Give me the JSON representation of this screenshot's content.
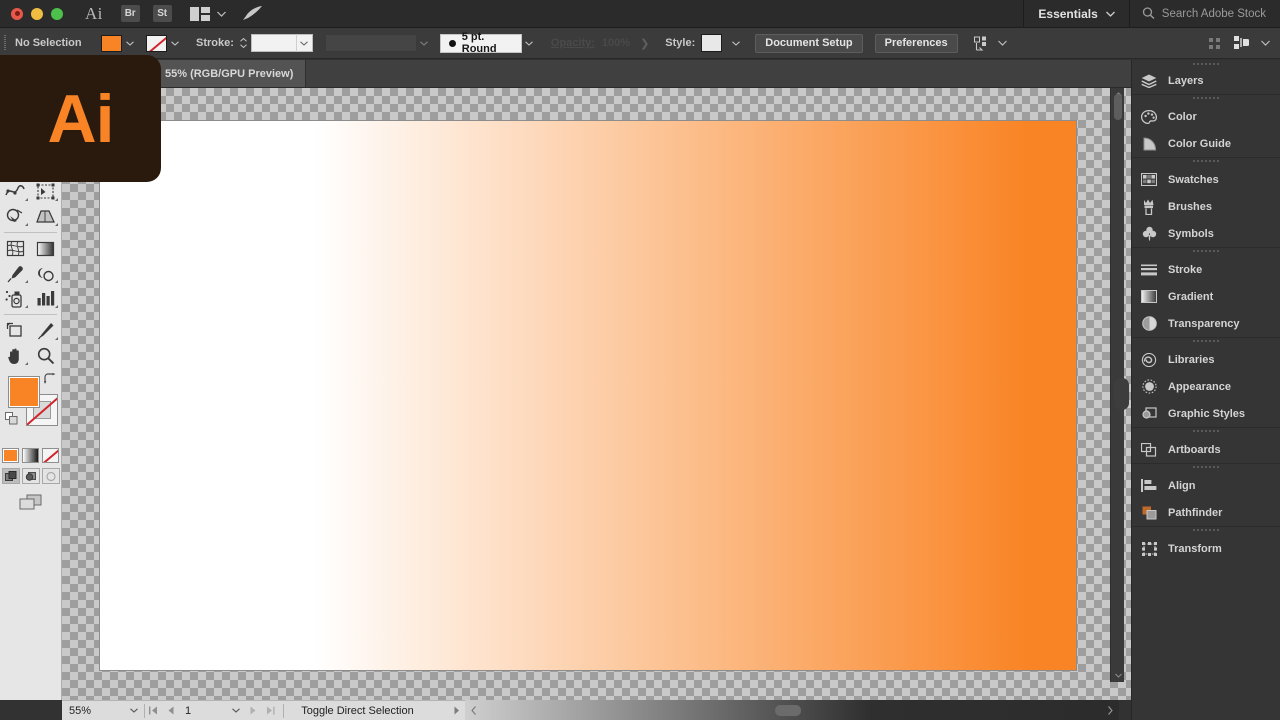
{
  "app": {
    "name": "Adobe Illustrator",
    "logo_text": "Ai",
    "brand_orange": "#f98425",
    "logo_bg": "#2a1a0e"
  },
  "titlebar": {
    "app_mark": "Ai",
    "bridge_label": "Br",
    "stock_label": "St",
    "arrange_icon": "arrange-documents-icon",
    "rocket_icon": "rocket-icon",
    "workspace": "Essentials",
    "search_placeholder": "Search Adobe Stock",
    "search_icon": "search-icon",
    "window_controls": [
      "close",
      "minimize",
      "maximize"
    ]
  },
  "control_bar": {
    "selection_status": "No Selection",
    "fill_color": "#f98425",
    "stroke_color": "none",
    "stroke_label": "Stroke:",
    "stroke_weight": "",
    "variable_width_profile": "",
    "brush_definition": "5 pt. Round",
    "opacity_label": "Opacity:",
    "opacity_value": "100%",
    "style_label": "Style:",
    "style_swatch": "#e8e8e8",
    "document_setup_label": "Document Setup",
    "preferences_label": "Preferences",
    "align_icon": "align-to-selection-icon",
    "arrange_icon": "arrange-icon",
    "drag_handle_icon": "drag-handle-icon"
  },
  "document_tab": {
    "label": "55% (RGB/GPU Preview)"
  },
  "tools": {
    "rows": [
      [
        {
          "name": "rectangle-tool",
          "icon": "rectangle-icon",
          "more": true
        },
        {
          "name": "paintbrush-tool",
          "icon": "paintbrush-icon",
          "more": true
        }
      ],
      [
        {
          "name": "shaper-tool",
          "icon": "shaper-pencil-icon",
          "more": true
        },
        {
          "name": "scissors-tool",
          "icon": "scissors-icon",
          "more": true
        }
      ],
      [
        {
          "name": "rotate-tool",
          "icon": "rotate-icon",
          "more": true
        },
        {
          "name": "scale-tool",
          "icon": "scale-icon",
          "more": true
        }
      ],
      [
        {
          "name": "width-tool",
          "icon": "width-warp-icon",
          "more": true
        },
        {
          "name": "free-transform-tool",
          "icon": "free-transform-icon",
          "more": true
        }
      ],
      [
        {
          "name": "shape-builder-tool",
          "icon": "shape-builder-icon",
          "more": true
        },
        {
          "name": "perspective-grid-tool",
          "icon": "perspective-grid-icon",
          "more": true
        }
      ],
      [
        {
          "name": "mesh-tool",
          "icon": "mesh-icon",
          "more": false
        },
        {
          "name": "gradient-tool",
          "icon": "gradient-icon",
          "more": false
        }
      ],
      [
        {
          "name": "eyedropper-tool",
          "icon": "eyedropper-icon",
          "more": true
        },
        {
          "name": "blend-tool",
          "icon": "blend-icon",
          "more": true
        }
      ],
      [
        {
          "name": "symbol-sprayer-tool",
          "icon": "symbol-sprayer-icon",
          "more": true
        },
        {
          "name": "column-graph-tool",
          "icon": "bar-graph-icon",
          "more": true
        }
      ],
      [
        {
          "name": "artboard-tool",
          "icon": "artboard-icon",
          "more": false
        },
        {
          "name": "slice-tool",
          "icon": "slice-knife-icon",
          "more": true
        }
      ],
      [
        {
          "name": "hand-tool",
          "icon": "hand-icon",
          "more": true
        },
        {
          "name": "zoom-tool",
          "icon": "magnifier-icon",
          "more": false
        }
      ]
    ],
    "fill_swatch_color": "#f98425",
    "stroke_swatch_color": "none",
    "swap_icon": "swap-fill-stroke-icon",
    "default_icon": "default-fill-stroke-icon",
    "fill_modes": [
      {
        "name": "color-mode",
        "icon": "solid-color-icon"
      },
      {
        "name": "gradient-mode",
        "icon": "gradient-swatch-icon"
      },
      {
        "name": "none-mode",
        "icon": "none-swatch-icon"
      }
    ],
    "draw_modes": [
      {
        "name": "draw-normal",
        "icon": "draw-normal-icon",
        "active": true
      },
      {
        "name": "draw-behind",
        "icon": "draw-behind-icon",
        "active": false
      },
      {
        "name": "draw-inside",
        "icon": "draw-inside-icon",
        "active": false
      }
    ],
    "screen_mode": {
      "name": "change-screen-mode",
      "icon": "screen-mode-icon"
    }
  },
  "canvas": {
    "artboard": {
      "gradient_from": "#ffffff",
      "gradient_to": "#f98425",
      "gradient_type": "linear-horizontal"
    },
    "background": "transparency-checkerboard"
  },
  "panel_dock": {
    "groups": [
      {
        "items": [
          {
            "label": "Layers",
            "icon": "layers-icon"
          }
        ]
      },
      {
        "items": [
          {
            "label": "Color",
            "icon": "color-palette-icon"
          },
          {
            "label": "Color Guide",
            "icon": "color-guide-icon"
          }
        ]
      },
      {
        "items": [
          {
            "label": "Swatches",
            "icon": "swatches-icon"
          },
          {
            "label": "Brushes",
            "icon": "brushes-icon"
          },
          {
            "label": "Symbols",
            "icon": "symbols-clover-icon"
          }
        ]
      },
      {
        "items": [
          {
            "label": "Stroke",
            "icon": "stroke-lines-icon"
          },
          {
            "label": "Gradient",
            "icon": "gradient-panel-icon"
          },
          {
            "label": "Transparency",
            "icon": "transparency-icon"
          }
        ]
      },
      {
        "items": [
          {
            "label": "Libraries",
            "icon": "libraries-cc-icon"
          },
          {
            "label": "Appearance",
            "icon": "appearance-icon"
          },
          {
            "label": "Graphic Styles",
            "icon": "graphic-styles-icon"
          }
        ]
      },
      {
        "items": [
          {
            "label": "Artboards",
            "icon": "artboards-icon"
          }
        ]
      },
      {
        "items": [
          {
            "label": "Align",
            "icon": "align-icon"
          },
          {
            "label": "Pathfinder",
            "icon": "pathfinder-icon"
          }
        ]
      },
      {
        "items": [
          {
            "label": "Transform",
            "icon": "transform-icon"
          }
        ]
      }
    ]
  },
  "status_bar": {
    "zoom_level": "55%",
    "page_number": "1",
    "status_text": "Toggle Direct Selection",
    "first_page_icon": "first-page-icon",
    "prev_page_icon": "prev-page-icon",
    "next_page_icon": "next-page-icon",
    "last_page_icon": "last-page-icon"
  }
}
